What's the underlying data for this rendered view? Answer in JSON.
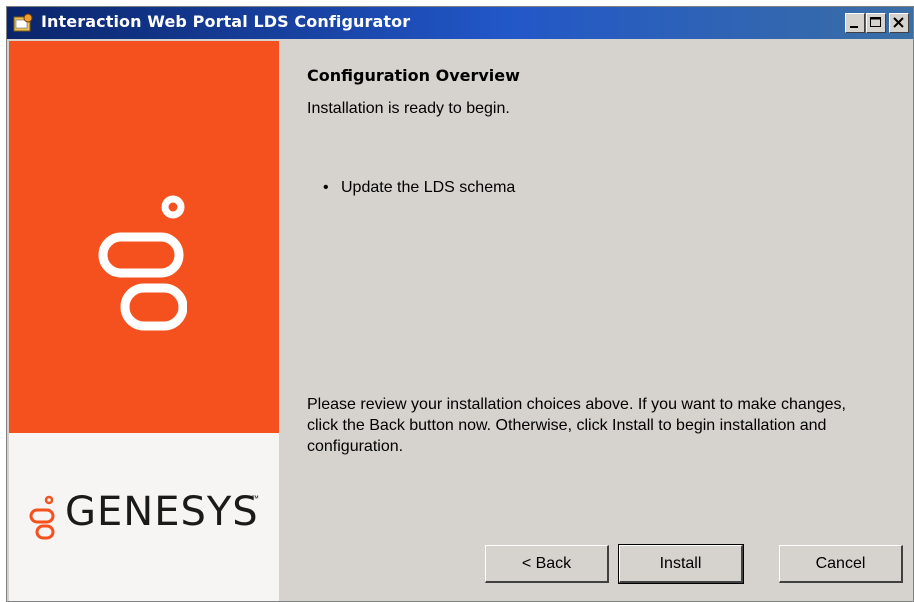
{
  "window": {
    "title": "Interaction Web Portal LDS Configurator"
  },
  "titlebar_buttons": {
    "minimize": "minimize-icon",
    "maximize": "maximize-icon",
    "close": "close-icon"
  },
  "branding": {
    "logo_mark": "genesys-logo-icon",
    "wordmark": "GENESYS",
    "trademark": "™",
    "accent_color": "#f4511e"
  },
  "content": {
    "heading": "Configuration Overview",
    "status": "Installation is ready to begin.",
    "items": [
      {
        "bullet": "•",
        "label": "Update the LDS schema"
      }
    ],
    "review_text": "Please review your installation choices above.  If you want to make changes, click the Back button now.  Otherwise, click Install to begin installation and configuration."
  },
  "buttons": {
    "back": "< Back",
    "install": "Install",
    "cancel": "Cancel"
  }
}
